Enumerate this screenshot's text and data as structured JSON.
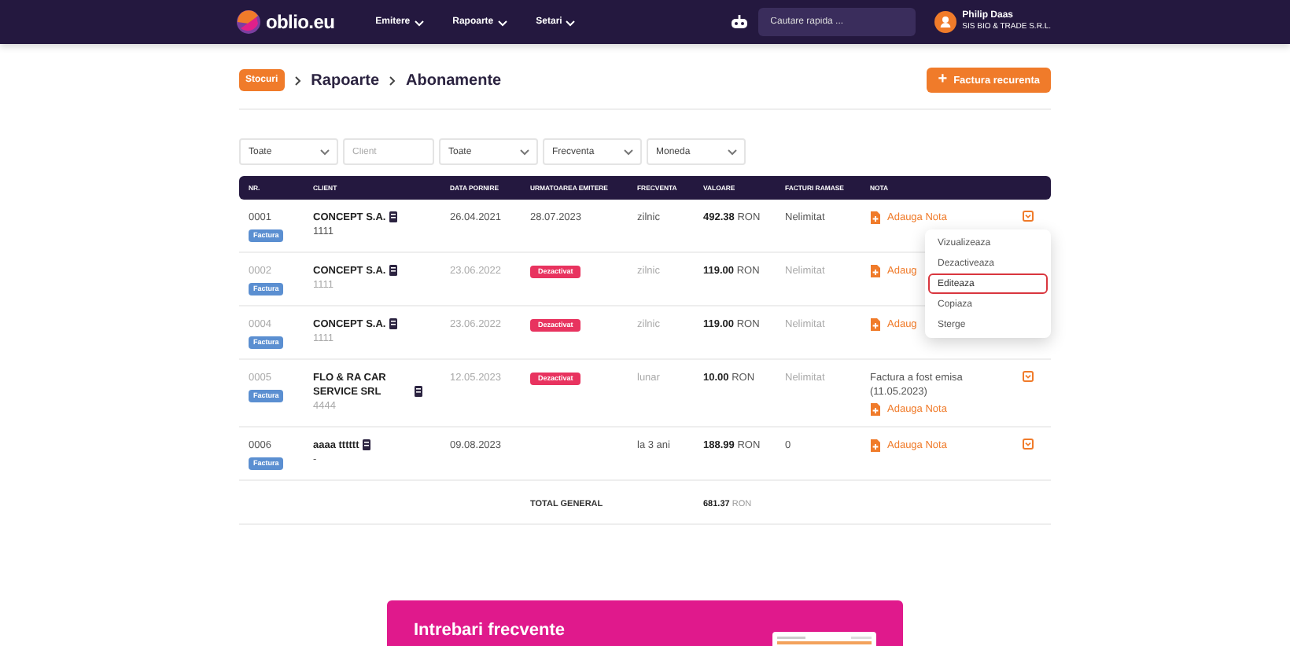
{
  "header": {
    "logo": "oblio.eu",
    "menu": [
      {
        "label": "Emitere"
      },
      {
        "label": "Rapoarte"
      },
      {
        "label": "Setari"
      }
    ],
    "search": {
      "placeholder": "Cautare rapida ..."
    },
    "user": {
      "name": "Philip Daas",
      "company": "SIS BIO & TRADE S.R.L."
    }
  },
  "breadcrumb": {
    "badge": "Stocuri",
    "items": [
      "Rapoarte",
      "Abonamente"
    ]
  },
  "new_button": {
    "icon": "+",
    "label": "Factura recurenta"
  },
  "filters": [
    {
      "kind": "select",
      "value": "Toate"
    },
    {
      "kind": "input",
      "placeholder": "Client"
    },
    {
      "kind": "select",
      "value": "Toate"
    },
    {
      "kind": "select",
      "value": "Frecventa"
    },
    {
      "kind": "select",
      "value": "Moneda"
    }
  ],
  "table": {
    "columns": [
      "NR.",
      "CLIENT",
      "DATA PORNIRE",
      "URMATOAREA EMITERE",
      "FRECVENTA",
      "VALOARE",
      "FACTURI RAMASE",
      "NOTA"
    ],
    "rows": [
      {
        "nr": "0001",
        "tag": "Factura",
        "client": "CONCEPT S.A.",
        "code": "1111",
        "start": "26.04.2021",
        "next": "28.07.2023",
        "frequency": "zilnic",
        "amount": "492.38",
        "currency": "RON",
        "remaining": "Nelimitat",
        "note_action": "Adauga Nota",
        "deactivated": false,
        "toggle": true
      },
      {
        "nr": "0002",
        "tag": "Factura",
        "client": "CONCEPT S.A.",
        "code": "1111",
        "start": "23.06.2022",
        "status": "Dezactivat",
        "frequency": "zilnic",
        "amount": "119.00",
        "currency": "RON",
        "remaining": "Nelimitat",
        "note_action": "Adaug",
        "deactivated": true,
        "toggle": false
      },
      {
        "nr": "0004",
        "tag": "Factura",
        "client": "CONCEPT S.A.",
        "code": "1111",
        "start": "23.06.2022",
        "status": "Dezactivat",
        "frequency": "zilnic",
        "amount": "119.00",
        "currency": "RON",
        "remaining": "Nelimitat",
        "note_action": "Adaug",
        "deactivated": true,
        "toggle": false
      },
      {
        "nr": "0005",
        "tag": "Factura",
        "client": "FLO & RA CAR SERVICE SRL",
        "code": "4444",
        "start": "12.05.2023",
        "status": "Dezactivat",
        "frequency": "lunar",
        "amount": "10.00",
        "currency": "RON",
        "remaining": "Nelimitat",
        "note": "Factura a fost emisa (11.05.2023)",
        "note_action": "Adauga Nota",
        "deactivated": true,
        "toggle": true
      },
      {
        "nr": "0006",
        "tag": "Factura",
        "client": "aaaa tttttt",
        "code": "-",
        "start": "09.08.2023",
        "frequency": "la 3 ani",
        "amount": "188.99",
        "currency": "RON",
        "remaining": "0",
        "note_action": "Adauga Nota",
        "deactivated": false,
        "toggle": true
      }
    ],
    "total": {
      "label": "TOTAL GENERAL",
      "amount": "681.37",
      "currency": "RON"
    }
  },
  "row_menu": {
    "items": [
      {
        "label": "Vizualizeaza",
        "selected": false
      },
      {
        "label": "Dezactiveaza",
        "selected": false
      },
      {
        "label": "Editeaza",
        "selected": true
      },
      {
        "label": "Copiaza",
        "selected": false
      },
      {
        "label": "Sterge",
        "selected": false
      }
    ]
  },
  "faq": {
    "title": "Intrebari frecvente"
  }
}
